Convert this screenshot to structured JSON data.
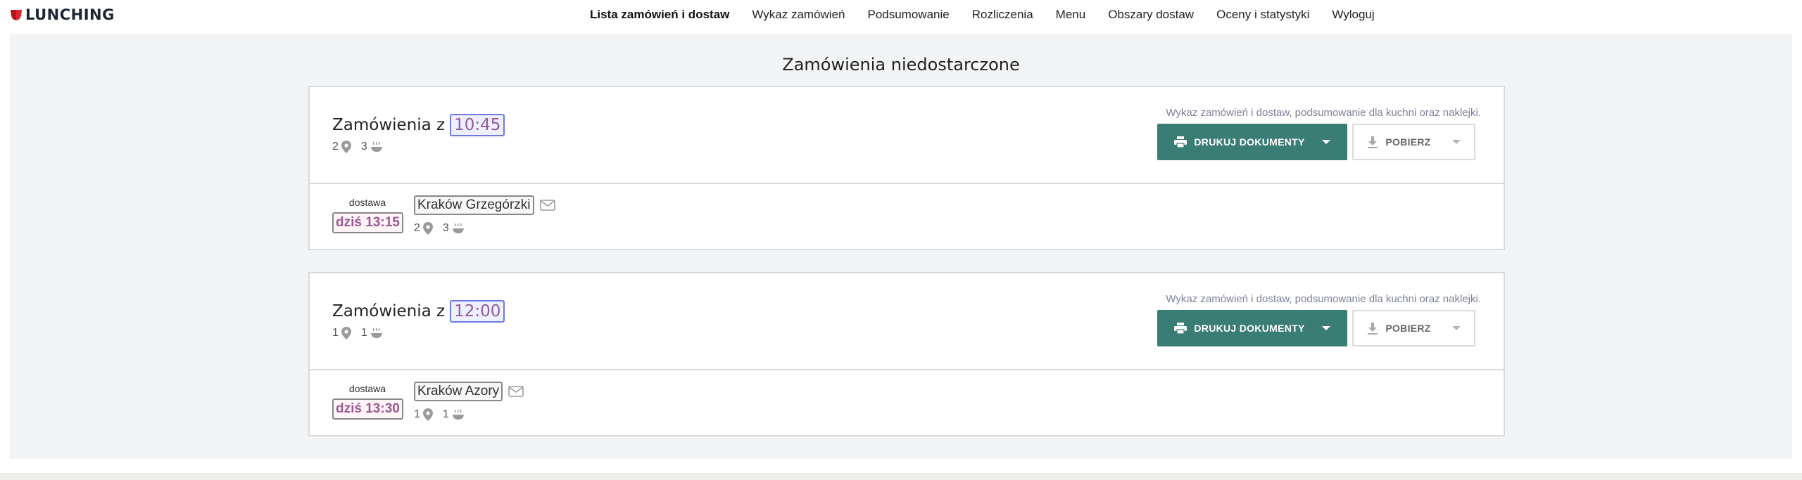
{
  "brand": {
    "name": "LUNCHING",
    "accent": "#e0242f"
  },
  "nav": {
    "items": [
      {
        "label": "Lista zamówień i dostaw",
        "active": true
      },
      {
        "label": "Wykaz zamówień"
      },
      {
        "label": "Podsumowanie"
      },
      {
        "label": "Rozliczenia"
      },
      {
        "label": "Menu"
      },
      {
        "label": "Obszary dostaw"
      },
      {
        "label": "Oceny i statystyki"
      },
      {
        "label": "Wyloguj"
      }
    ]
  },
  "page": {
    "title": "Zamówienia niedostarczone"
  },
  "colors": {
    "primary_button": "#3a7d74",
    "time_badge_border": "#6d79e3",
    "delivery_time_text": "#9a5a90"
  },
  "groups": [
    {
      "title_prefix": "Zamówienia z",
      "time": "10:45",
      "locations_count": "2",
      "meals_count": "3",
      "docs_note": "Wykaz zamówień i dostaw, podsumowanie dla kuchni oraz naklejki.",
      "print_label": "DRUKUJ DOKUMENTY",
      "download_label": "POBIERZ",
      "delivery": {
        "label": "dostawa",
        "time": "dziś 13:15",
        "place": "Kraków Grzegórzki",
        "locations_count": "2",
        "meals_count": "3"
      }
    },
    {
      "title_prefix": "Zamówienia z",
      "time": "12:00",
      "locations_count": "1",
      "meals_count": "1",
      "docs_note": "Wykaz zamówień i dostaw, podsumowanie dla kuchni oraz naklejki.",
      "print_label": "DRUKUJ DOKUMENTY",
      "download_label": "POBIERZ",
      "delivery": {
        "label": "dostawa",
        "time": "dziś 13:30",
        "place": "Kraków Azory",
        "locations_count": "1",
        "meals_count": "1"
      }
    }
  ],
  "icons": [
    "logo-mark-icon",
    "location-pin-icon",
    "meal-bowl-icon",
    "printer-icon",
    "download-icon",
    "envelope-icon",
    "caret-down-icon"
  ]
}
